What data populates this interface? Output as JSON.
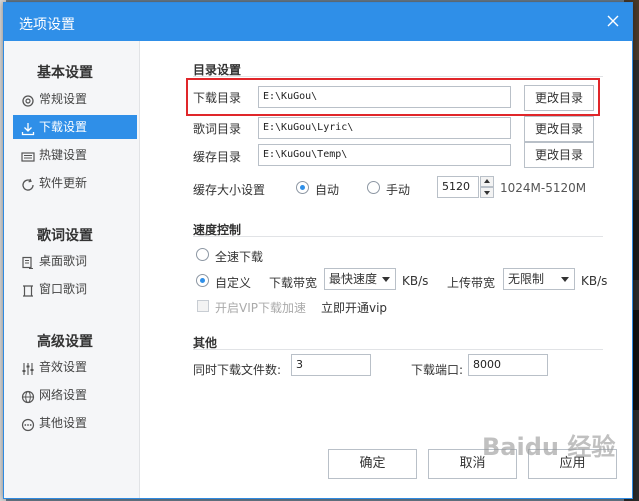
{
  "dialog": {
    "title": "选项设置"
  },
  "sidebar": {
    "groups": [
      {
        "title": "基本设置",
        "items": [
          {
            "label": "常规设置",
            "icon": "gear-icon"
          },
          {
            "label": "下载设置",
            "icon": "download-icon",
            "active": true
          },
          {
            "label": "热键设置",
            "icon": "keyboard-icon"
          },
          {
            "label": "软件更新",
            "icon": "refresh-icon"
          }
        ]
      },
      {
        "title": "歌词设置",
        "items": [
          {
            "label": "桌面歌词",
            "icon": "desktop-lyric-icon"
          },
          {
            "label": "窗口歌词",
            "icon": "window-lyric-icon"
          }
        ]
      },
      {
        "title": "高级设置",
        "items": [
          {
            "label": "音效设置",
            "icon": "equalizer-icon"
          },
          {
            "label": "网络设置",
            "icon": "globe-icon"
          },
          {
            "label": "其他设置",
            "icon": "more-icon"
          }
        ]
      }
    ]
  },
  "directory": {
    "title": "目录设置",
    "download": {
      "label": "下载目录",
      "value": "E:\\KuGou\\",
      "button": "更改目录"
    },
    "lyric": {
      "label": "歌词目录",
      "value": "E:\\KuGou\\Lyric\\",
      "button": "更改目录"
    },
    "cache": {
      "label": "缓存目录",
      "value": "E:\\KuGou\\Temp\\",
      "button": "更改目录"
    },
    "cache_size": {
      "label": "缓存大小设置",
      "auto_label": "自动",
      "manual_label": "手动",
      "selected": "auto",
      "value": "5120",
      "range": "1024M-5120M"
    }
  },
  "speed": {
    "title": "速度控制",
    "full_speed_label": "全速下载",
    "custom_label": "自定义",
    "selected": "custom",
    "download_bw_label": "下载带宽",
    "download_bw_value": "最快速度",
    "download_unit": "KB/s",
    "upload_bw_label": "上传带宽",
    "upload_bw_value": "无限制",
    "upload_unit": "KB/s",
    "vip_label": "开启VIP下载加速",
    "vip_link": "立即开通vip"
  },
  "other": {
    "title": "其他",
    "concurrent_label": "同时下载文件数:",
    "concurrent_value": "3",
    "port_label": "下载端口:",
    "port_value": "8000"
  },
  "footer": {
    "ok": "确定",
    "cancel": "取消",
    "apply": "应用"
  },
  "watermark": "Baidu 经验",
  "colors": {
    "accent": "#2f8fe8",
    "highlight": "#e0262a"
  }
}
